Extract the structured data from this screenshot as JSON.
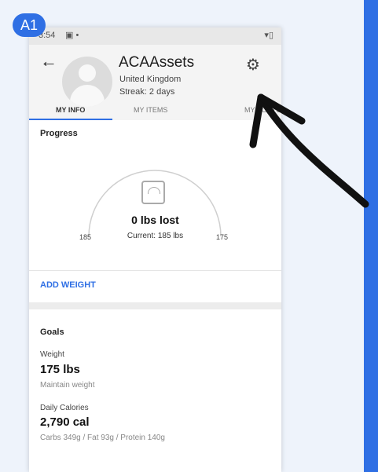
{
  "badge": "A1",
  "status_bar": {
    "time": "3:54",
    "left_icons": "▣ •",
    "right_icons": "▾▯"
  },
  "profile": {
    "username": "ACAAssets",
    "country": "United Kingdom",
    "streak": "Streak: 2 days"
  },
  "tabs": [
    {
      "label": "MY INFO",
      "active": true
    },
    {
      "label": "MY ITEMS",
      "active": false
    },
    {
      "label": "MY POSTS",
      "active": false
    }
  ],
  "progress": {
    "title": "Progress",
    "lost_label": "0 lbs lost",
    "start_weight": "185",
    "current_weight": "Current: 185 lbs",
    "goal_weight": "175",
    "fraction_complete": 0
  },
  "add_weight_label": "ADD WEIGHT",
  "goals": {
    "title": "Goals",
    "weight_label": "Weight",
    "weight_value": "175 lbs",
    "weight_sub": "Maintain weight",
    "calories_label": "Daily Calories",
    "calories_value": "2,790 cal",
    "calories_sub": "Carbs 349g / Fat 93g / Protein 140g"
  },
  "colors": {
    "accent": "#2f6fe4",
    "background": "#eef3fb"
  },
  "icons": {
    "back": "back-arrow-icon",
    "settings": "gear-icon",
    "scale": "scale-icon",
    "pointer": "curved-arrow-icon"
  }
}
